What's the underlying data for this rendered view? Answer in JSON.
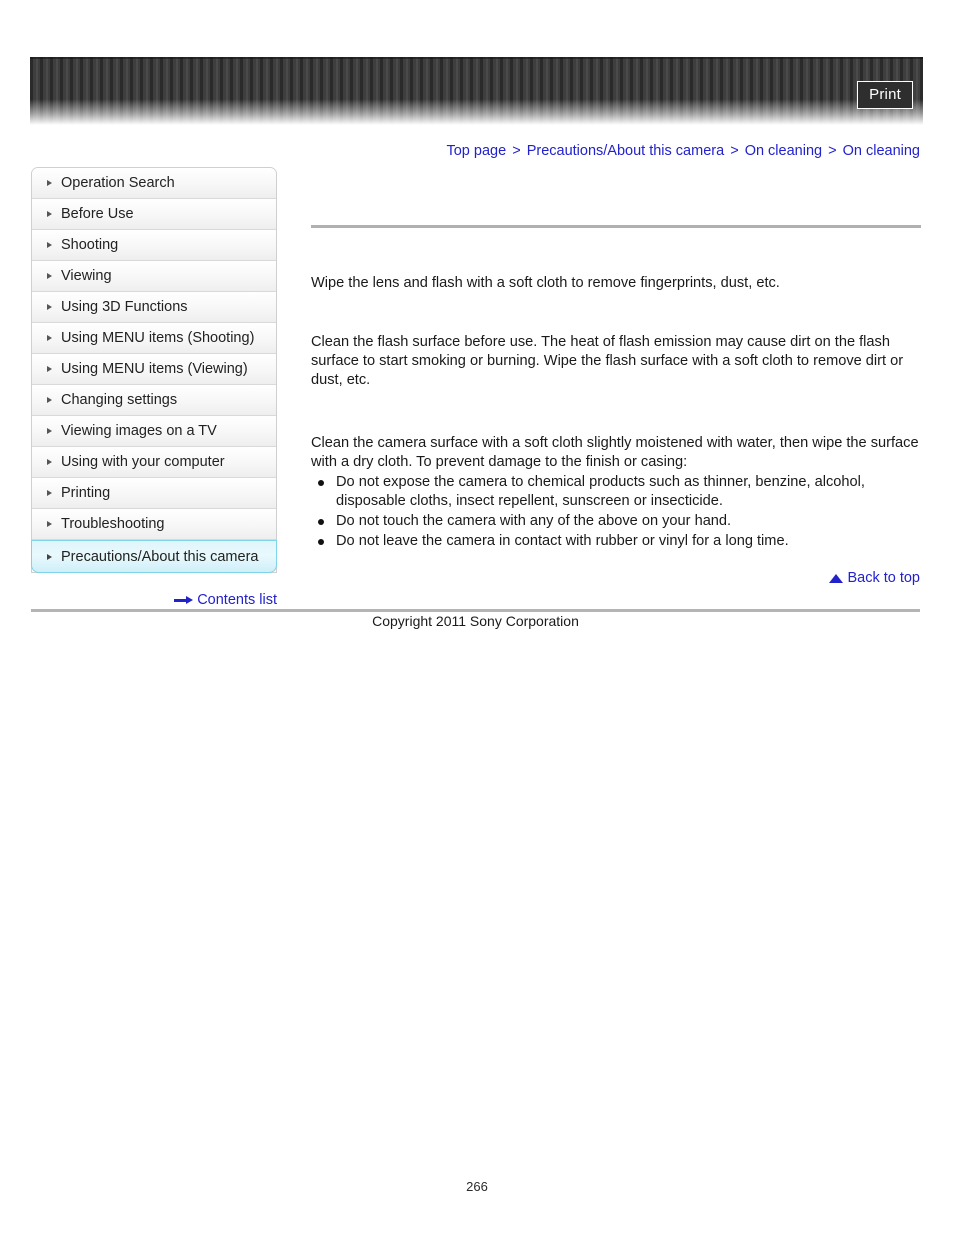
{
  "header": {
    "print_label": "Print"
  },
  "breadcrumb": {
    "separator": ">",
    "items": [
      {
        "label": "Top page"
      },
      {
        "label": "Precautions/About this camera"
      },
      {
        "label": "On cleaning"
      },
      {
        "label": "On cleaning"
      }
    ]
  },
  "sidebar": {
    "items": [
      {
        "label": "Operation Search",
        "selected": false
      },
      {
        "label": "Before Use",
        "selected": false
      },
      {
        "label": "Shooting",
        "selected": false
      },
      {
        "label": "Viewing",
        "selected": false
      },
      {
        "label": "Using 3D Functions",
        "selected": false
      },
      {
        "label": "Using MENU items (Shooting)",
        "selected": false
      },
      {
        "label": "Using MENU items (Viewing)",
        "selected": false
      },
      {
        "label": "Changing settings",
        "selected": false
      },
      {
        "label": "Viewing images on a TV",
        "selected": false
      },
      {
        "label": "Using with your computer",
        "selected": false
      },
      {
        "label": "Printing",
        "selected": false
      },
      {
        "label": "Troubleshooting",
        "selected": false
      },
      {
        "label": "Precautions/About this camera",
        "selected": true
      }
    ],
    "contents_list_label": "Contents list"
  },
  "main": {
    "paragraph_1": "Wipe the lens and flash with a soft cloth to remove fingerprints, dust, etc.",
    "paragraph_2": "Clean the flash surface before use. The heat of flash emission may cause dirt on the flash surface to start smoking or burning. Wipe the flash surface with a soft cloth to remove dirt or dust, etc.",
    "paragraph_3": "Clean the camera surface with a soft cloth slightly moistened with water, then wipe the surface with a dry cloth. To prevent damage to the finish or casing:",
    "bullets": [
      "Do not expose the camera to chemical products such as thinner, benzine, alcohol, disposable cloths, insect repellent, sunscreen or insecticide.",
      "Do not touch the camera with any of the above on your hand.",
      "Do not leave the camera in contact with rubber or vinyl for a long time."
    ],
    "back_to_top_label": "Back to top"
  },
  "footer": {
    "copyright": "Copyright 2011 Sony Corporation",
    "page_number": "266"
  },
  "colors": {
    "link": "#2222cc",
    "selected_nav_border": "#7fd4e8",
    "rule": "#b0b0b0"
  }
}
